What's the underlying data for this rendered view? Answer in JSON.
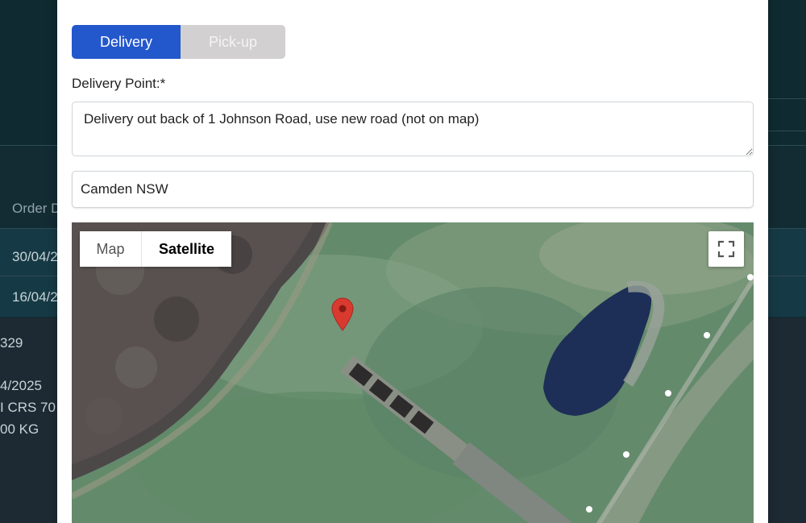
{
  "background": {
    "table_header": "Order D",
    "rows": [
      "30/04/2",
      "16/04/2"
    ],
    "details": [
      "329",
      "4/2025",
      "I CRS 70",
      "00 KG"
    ]
  },
  "modal": {
    "tabs": [
      {
        "label": "Delivery",
        "active": true
      },
      {
        "label": "Pick-up",
        "active": false
      }
    ],
    "delivery_point_label": "Delivery Point:*",
    "delivery_point_value": "Delivery out back of 1 Johnson Road, use new road (not on map)",
    "location_value": "Camden NSW",
    "map": {
      "type_options": [
        "Map",
        "Satellite"
      ],
      "selected_type": "Satellite",
      "fullscreen_icon": "fullscreen-icon",
      "marker_icon": "map-pin-icon",
      "marker_color": "#d93a2f"
    }
  },
  "colors": {
    "accent": "#2357cc",
    "inactive_tab": "#d2d0d0",
    "background": "#132b33"
  }
}
